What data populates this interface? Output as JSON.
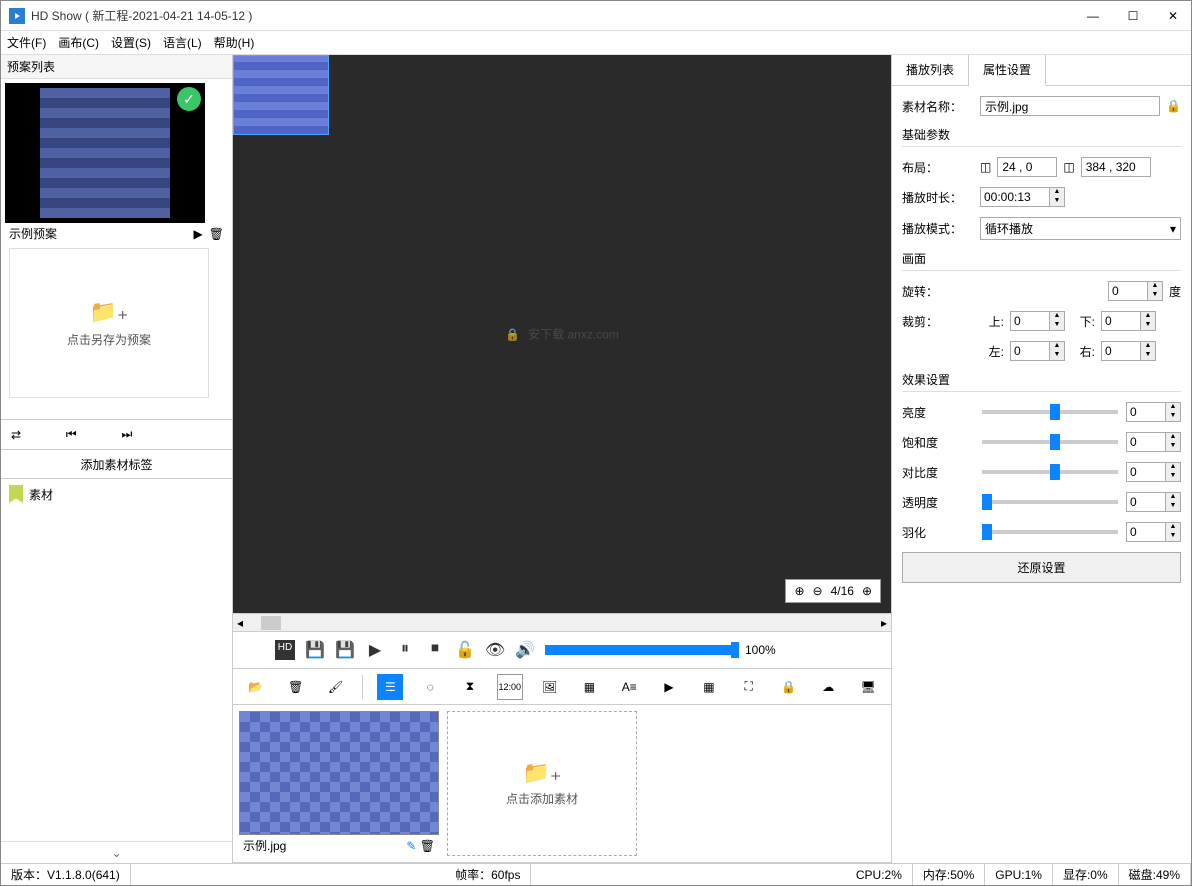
{
  "window": {
    "title": "HD Show ( 新工程-2021-04-21 14-05-12 )"
  },
  "menu": {
    "file": "文件(F)",
    "canvas": "画布(C)",
    "settings": "设置(S)",
    "language": "语言(L)",
    "help": "帮助(H)"
  },
  "presets": {
    "header": "预案列表",
    "items": [
      {
        "name": "示例预案"
      }
    ],
    "save_hint": "点击另存为预案"
  },
  "left_tabs": {
    "add_label": "添加素材标签",
    "material": "素材"
  },
  "canvas": {
    "zoom": {
      "text": "4/16"
    },
    "watermark": "安下载 anxz.com"
  },
  "player": {
    "volume_label": "100%"
  },
  "right": {
    "tabs": {
      "playlist": "播放列表",
      "props": "属性设置"
    },
    "material_name_label": "素材名称：",
    "material_name": "示例.jpg",
    "basic_label": "基础参数",
    "layout_label": "布局：",
    "layout_pos": "24 , 0",
    "layout_size": "384 , 320",
    "duration_label": "播放时长：",
    "duration": "00:00:13",
    "mode_label": "播放模式：",
    "mode": "循环播放",
    "screen_label": "画面",
    "rotate_label": "旋转：",
    "rotate_val": "0",
    "rotate_unit": "度",
    "crop_label": "裁剪：",
    "crop": {
      "top_l": "上:",
      "top_v": "0",
      "bottom_l": "下:",
      "bottom_v": "0",
      "left_l": "左:",
      "left_v": "0",
      "right_l": "右:",
      "right_v": "0"
    },
    "effect_label": "效果设置",
    "brightness_l": "亮度",
    "brightness_v": "0",
    "saturation_l": "饱和度",
    "saturation_v": "0",
    "contrast_l": "对比度",
    "contrast_v": "0",
    "opacity_l": "透明度",
    "opacity_v": "0",
    "feather_l": "羽化",
    "feather_v": "0",
    "reset": "还原设置"
  },
  "materials": {
    "add_hint": "点击添加素材",
    "items": [
      {
        "name": "示例.jpg"
      }
    ]
  },
  "status": {
    "version": "版本：V1.1.8.0(641)",
    "fps": "帧率：60fps",
    "cpu": "CPU:2%",
    "mem": "内存:50%",
    "gpu": "GPU:1%",
    "vram": "显存:0%",
    "disk": "磁盘:49%"
  }
}
